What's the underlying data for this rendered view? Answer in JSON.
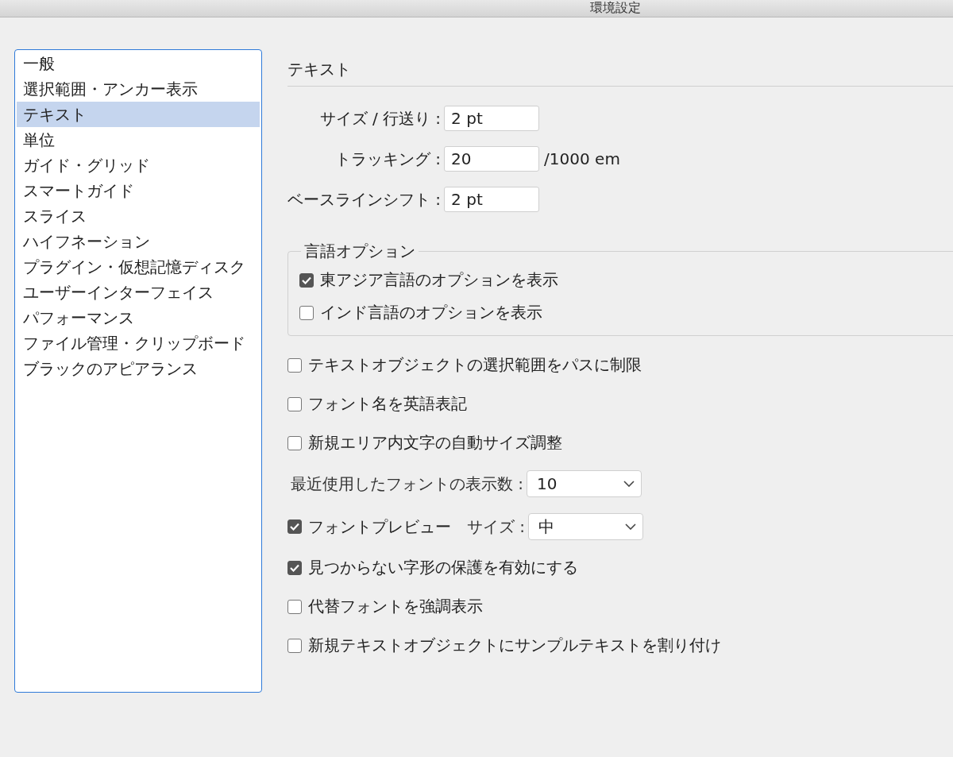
{
  "window": {
    "title": "環境設定"
  },
  "sidebar": {
    "items": [
      {
        "label": "一般",
        "selected": false
      },
      {
        "label": "選択範囲・アンカー表示",
        "selected": false
      },
      {
        "label": "テキスト",
        "selected": true
      },
      {
        "label": "単位",
        "selected": false
      },
      {
        "label": "ガイド・グリッド",
        "selected": false
      },
      {
        "label": "スマートガイド",
        "selected": false
      },
      {
        "label": "スライス",
        "selected": false
      },
      {
        "label": "ハイフネーション",
        "selected": false
      },
      {
        "label": "プラグイン・仮想記憶ディスク",
        "selected": false
      },
      {
        "label": "ユーザーインターフェイス",
        "selected": false
      },
      {
        "label": "パフォーマンス",
        "selected": false
      },
      {
        "label": "ファイル管理・クリップボード",
        "selected": false
      },
      {
        "label": "ブラックのアピアランス",
        "selected": false
      }
    ]
  },
  "section": {
    "title": "テキスト"
  },
  "fields": [
    {
      "label": "サイズ / 行送り :",
      "value": "2 pt"
    },
    {
      "label": "トラッキング :",
      "value": "20",
      "unit": "/1000 em"
    },
    {
      "label": "ベースラインシフト :",
      "value": "2 pt"
    }
  ],
  "language_options": {
    "title": "言語オプション",
    "options": [
      {
        "label": "東アジア言語のオプションを表示",
        "checked": true
      },
      {
        "label": "インド言語のオプションを表示",
        "checked": false
      }
    ]
  },
  "options": [
    {
      "kind": "checkbox",
      "label": "テキストオブジェクトの選択範囲をパスに制限",
      "checked": false
    },
    {
      "kind": "checkbox",
      "label": "フォント名を英語表記",
      "checked": false
    },
    {
      "kind": "checkbox",
      "label": "新規エリア内文字の自動サイズ調整",
      "checked": false
    },
    {
      "kind": "select",
      "label": "最近使用したフォントの表示数 :",
      "value": "10"
    },
    {
      "kind": "checkbox_select",
      "label": "フォントプレビュー",
      "checked": true,
      "select_label": "サイズ :",
      "value": "中"
    },
    {
      "kind": "checkbox",
      "label": "見つからない字形の保護を有効にする",
      "checked": true
    },
    {
      "kind": "checkbox",
      "label": "代替フォントを強調表示",
      "checked": false
    },
    {
      "kind": "checkbox",
      "label": "新規テキストオブジェクトにサンプルテキストを割り付け",
      "checked": false
    }
  ]
}
